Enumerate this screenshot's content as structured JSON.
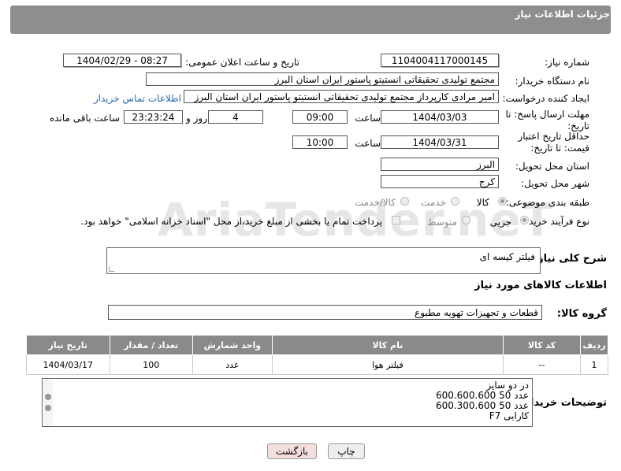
{
  "header": {
    "title": "جزئیات اطلاعات نیاز"
  },
  "labels": {
    "need_number": "شماره نیاز:",
    "announce_datetime": "تاریخ و ساعت اعلان عمومی:",
    "buyer_org": "نام دستگاه خریدار:",
    "requester": "ایجاد کننده درخواست:",
    "buyer_contact": "اطلاعات تماس خریدار",
    "reply_deadline": "مهلت ارسال پاسخ: تا تاریخ:",
    "hour": "ساعت",
    "day_and": "روز و",
    "hours_left": "ساعت باقی مانده",
    "price_validity": "حداقل تاریخ اعتبار قیمت: تا تاریخ:",
    "hour2": "ساعت",
    "province": "استان محل تحویل:",
    "city": "شهر محل تحویل:",
    "category": "طبقه بندی موضوعی:",
    "process_type": "نوع فرآیند خرید :",
    "general_desc": "شرح کلی نیاز:",
    "items_info": "اطلاعات کالاهای مورد نیاز",
    "goods_group": "گروه کالا:",
    "buyer_notes": "توضیحات خریدار:"
  },
  "values": {
    "need_number": "1104004117000145",
    "announce_datetime": "1404/02/29 - 08:27",
    "buyer_org": "مجتمع تولیدی تحقیقاتی انستیتو پاستور ایران استان البرز",
    "requester": "امیر مرادی کارپرداز مجتمع تولیدی تحقیقاتی انستیتو پاستور ایران استان البرز",
    "reply_date": "1404/03/03",
    "reply_time": "09:00",
    "days_left": "4",
    "time_left": "23:23:24",
    "validity_date": "1404/03/31",
    "validity_time": "10:00",
    "province": "البرز",
    "city": "کرج",
    "general_desc": "فیلتر کیسه ای",
    "goods_group": "قطعات و تجهیزات تهویه مطبوع"
  },
  "category_options": {
    "goods": "کالا",
    "service": "خدمت",
    "goods_service": "کالا/خدمت"
  },
  "process_options": {
    "minor": "جزیی",
    "medium": "متوسط",
    "payment_note": "پرداخت تمام یا بخشی از مبلغ خرید،از محل \"اسناد خزانه اسلامی\" خواهد بود."
  },
  "table": {
    "headers": [
      "ردیف",
      "کد کالا",
      "نام کالا",
      "واحد شمارش",
      "تعداد / مقدار",
      "تاریخ نیاز"
    ],
    "rows": [
      [
        "1",
        "--",
        "فیلتر هوا",
        "عدد",
        "100",
        "1404/03/17"
      ]
    ]
  },
  "notes_lines": [
    "در دو سایز",
    "600.600.600   50 عدد",
    "600.300.600   50 عدد",
    "کارایی F7"
  ],
  "buttons": {
    "print": "چاپ",
    "back": "بازگشت"
  },
  "watermark": "AriaTender.neT",
  "colors": {
    "header_bg": "#8e8e8e",
    "table_header_bg": "#8a8a8a",
    "link": "#2b6cb0",
    "back_button_bg": "#f5dede"
  }
}
